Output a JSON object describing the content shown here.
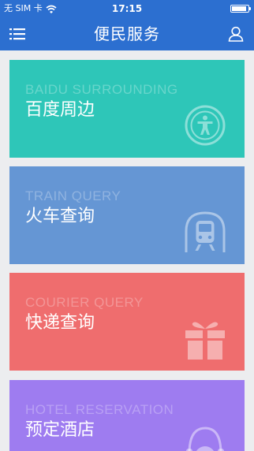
{
  "status_bar": {
    "carrier": "无 SIM 卡",
    "time": "17:15",
    "battery_level": 0.9
  },
  "nav": {
    "title": "便民服务",
    "left_icon": "menu-icon",
    "right_icon": "user-icon"
  },
  "cards": [
    {
      "en": "BAIDU SURROUNDING",
      "cn": "百度周边",
      "icon": "accessibility-icon",
      "color": "#2ec6b8"
    },
    {
      "en": "TRAIN QUERY",
      "cn": "火车查询",
      "icon": "train-icon",
      "color": "#6596d4"
    },
    {
      "en": "COURIER QUERY",
      "cn": "快递查询",
      "icon": "gift-icon",
      "color": "#ef6d6e"
    },
    {
      "en": "HOTEL RESERVATION",
      "cn": "预定酒店",
      "icon": "hotel-icon",
      "color": "#9e7cf0"
    }
  ]
}
